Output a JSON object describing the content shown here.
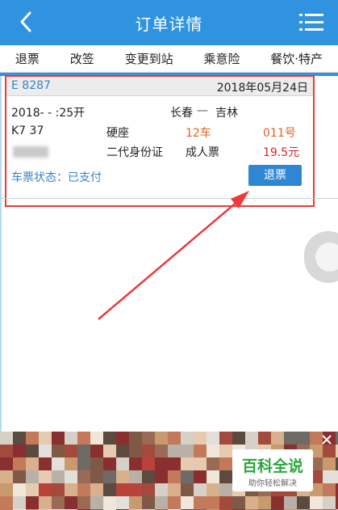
{
  "header": {
    "title": "订单详情",
    "back_icon": "chevron-left-icon",
    "menu_icon": "list-menu-icon"
  },
  "tabs": [
    {
      "label": "退票"
    },
    {
      "label": "改签"
    },
    {
      "label": "变更到站"
    },
    {
      "label": "乘意险"
    },
    {
      "label": "餐饮·特产"
    }
  ],
  "order": {
    "order_no": "E      8287",
    "date": "2018年05月24日",
    "depart_time": "2018-  -   :25开",
    "route_from": "长春",
    "route_sep": "—",
    "route_to": "吉林",
    "train_no": "K7  37",
    "seat_type": "硬座",
    "car": "12车",
    "seat_no": "011号",
    "passenger_name": "   ",
    "id_type": "二代身份证",
    "ticket_type": "成人票",
    "price": "19.5元",
    "status": "车票状态：已支付",
    "refund_button": "退票"
  },
  "ad": {
    "brand": "百科全说",
    "tagline": "助你轻松解决"
  },
  "colors": {
    "primary": "#2f93e0",
    "link": "#3a82c9",
    "highlight_border": "#ea3a3a",
    "car_orange": "#e2641e",
    "price_red": "#d7262b",
    "brand_green": "#2aa63b"
  }
}
